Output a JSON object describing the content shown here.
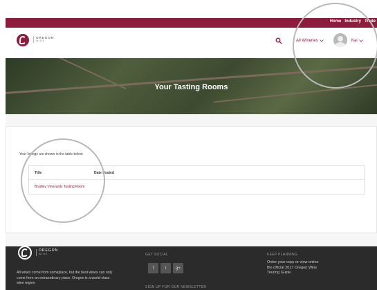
{
  "topbar": {
    "links": [
      "Home",
      "Industry",
      "Trade"
    ]
  },
  "brand": {
    "name": "OREGON",
    "sub": "WINE"
  },
  "header": {
    "wineries": "All Wineries",
    "user": "Kai"
  },
  "hero": {
    "title": "Your Tasting Rooms"
  },
  "content": {
    "intro": "Your listings are shown in the table below.",
    "columns": [
      "Title",
      "Date Posted"
    ],
    "rows": [
      {
        "title": "Bradley Vineyards Tasting Room",
        "date": ""
      }
    ]
  },
  "footer": {
    "description": "All wines come from someplace, but the best wines can only come from an extraordinary place. Oregon is a world-class wine region",
    "social_heading": "GET SOCIAL",
    "social": [
      "f",
      "t",
      "g+"
    ],
    "newsletter_heading": "SIGN UP FOR OUR NEWSLETTER",
    "plan_heading": "KEEP PLANNING",
    "plan_text": "Order your copy or view online the official 2017 Oregon Wine Touring Guide."
  },
  "colors": {
    "brand": "#8c1d3e",
    "footer": "#2b2b2b"
  },
  "icons": {
    "search": "search-icon",
    "chevron": "chevron-down-icon",
    "avatar": "avatar-icon"
  }
}
